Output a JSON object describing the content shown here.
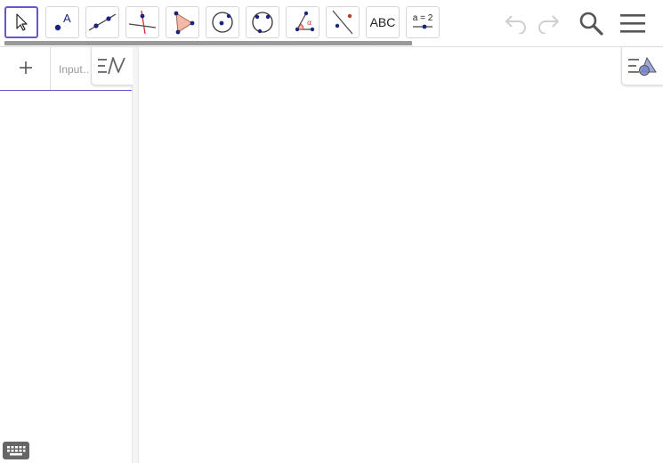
{
  "toolbar": {
    "tools": [
      {
        "name": "move-tool",
        "icon": "arrow-cursor-icon",
        "selected": true
      },
      {
        "name": "point-tool",
        "icon": "point-icon",
        "label": "A"
      },
      {
        "name": "line-tool",
        "icon": "line-through-two-points-icon"
      },
      {
        "name": "perpendicular-line-tool",
        "icon": "perpendicular-line-icon"
      },
      {
        "name": "polygon-tool",
        "icon": "polygon-icon"
      },
      {
        "name": "circle-tool",
        "icon": "circle-center-point-icon"
      },
      {
        "name": "circle-three-points-tool",
        "icon": "circle-three-points-icon"
      },
      {
        "name": "angle-tool",
        "icon": "angle-icon",
        "label": "α"
      },
      {
        "name": "reflect-tool",
        "icon": "reflect-about-line-icon"
      },
      {
        "name": "text-tool",
        "icon": "text-icon",
        "label": "ABC"
      },
      {
        "name": "slider-tool",
        "icon": "slider-icon",
        "label": "a = 2"
      }
    ],
    "accent_color": "#6557d2",
    "undo_icon": "undo-icon",
    "redo_icon": "redo-icon",
    "search_icon": "search-icon",
    "menu_icon": "hamburger-menu-icon"
  },
  "algebra": {
    "add_icon": "plus-icon",
    "input_placeholder": "Input…",
    "style_toggle_icon": "algebra-style-icon"
  },
  "graphics": {
    "style_toggle_icon": "graphics-style-icon"
  },
  "keyboard_icon": "keyboard-icon"
}
